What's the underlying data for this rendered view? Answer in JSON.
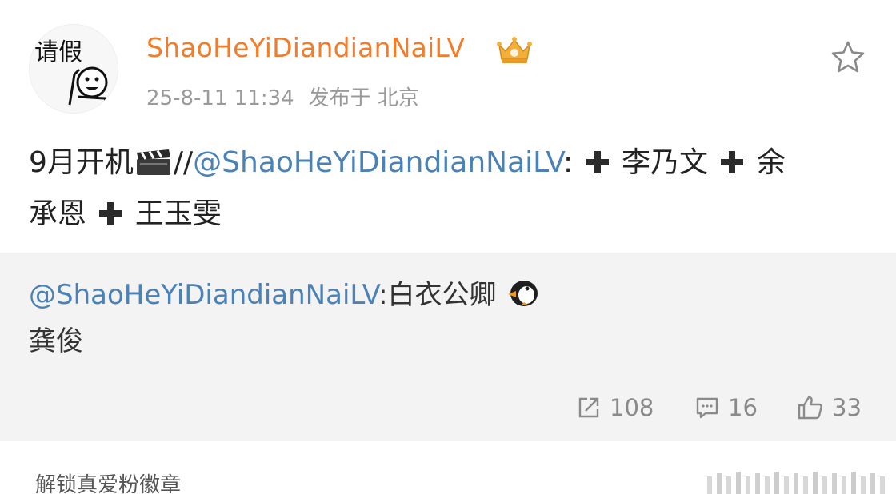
{
  "post": {
    "username": "ShaoHeYiDiandianNaiLV",
    "timestamp": "25-8-11 11:34",
    "location": "发布于 北京",
    "avatar_text": "请假",
    "content": {
      "text_1": "9月开机",
      "separator": "//",
      "mention": "@ShaoHeYiDiandianNaiLV",
      "colon": ":",
      "name_1": "李乃文",
      "name_2_part_a": "余",
      "name_2_part_b": "承恩",
      "name_3": "王玉雯"
    },
    "repost": {
      "mention": "@ShaoHeYiDiandianNaiLV",
      "text": ":白衣公卿",
      "line_2": "龚俊"
    },
    "actions": {
      "repost_count": "108",
      "comment_count": "16",
      "like_count": "33"
    },
    "footer": {
      "label": "解锁真爱粉徽章"
    }
  },
  "colors": {
    "username": "#f47c28",
    "mention": "#4a82b8",
    "meta": "#9a9a9a",
    "repost_bg": "#f3f3f3"
  },
  "icons": [
    "avatar-illustration",
    "vip-crown-badge",
    "star-icon",
    "clapper-board-emoji",
    "plus-icon",
    "penguin-emoji",
    "repost-icon",
    "comment-icon",
    "like-icon"
  ]
}
